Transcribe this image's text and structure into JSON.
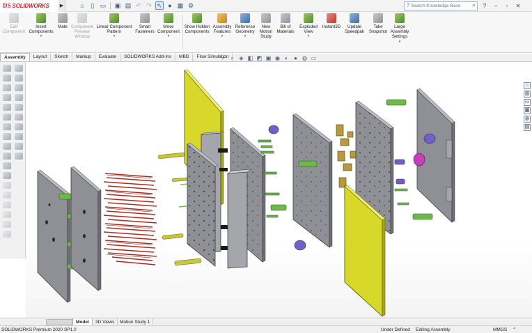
{
  "app": {
    "brand": "SOLIDWORKS",
    "brand_mark": "DS"
  },
  "search": {
    "placeholder": "Search Knowledge Base"
  },
  "ribbon": {
    "buttons": [
      {
        "label": "Edit Component",
        "disabled": true
      },
      {
        "label": "Insert Components",
        "disabled": false
      },
      {
        "label": "Mate",
        "disabled": false
      },
      {
        "label": "Component Preview Window",
        "disabled": true
      },
      {
        "label": "Linear Component Pattern",
        "disabled": false
      },
      {
        "label": "Smart Fasteners",
        "disabled": false
      },
      {
        "label": "Move Component",
        "disabled": false
      },
      {
        "label": "Show Hidden Components",
        "disabled": false
      },
      {
        "label": "Assembly Features",
        "disabled": false
      },
      {
        "label": "Reference Geometry",
        "disabled": false
      },
      {
        "label": "New Motion Study",
        "disabled": false
      },
      {
        "label": "Bill of Materials",
        "disabled": false
      },
      {
        "label": "Exploded View",
        "disabled": false
      },
      {
        "label": "Instant3D",
        "disabled": false
      },
      {
        "label": "Update Speedpak",
        "disabled": false
      },
      {
        "label": "Take Snapshot",
        "disabled": false
      },
      {
        "label": "Large Assembly Settings",
        "disabled": false
      }
    ]
  },
  "tabs": [
    "Assembly",
    "Layout",
    "Sketch",
    "Markup",
    "Evaluate",
    "SOLIDWORKS Add-Ins",
    "MBD",
    "Flow Simulation"
  ],
  "active_tab": "Assembly",
  "bottom_tabs": [
    "Model",
    "3D Views",
    "Motion Study 1"
  ],
  "active_bottom_tab": "Model",
  "status": {
    "product": "SOLIDWORKS Premium 2020 SP1.0",
    "state": "Under Defined",
    "mode": "Editing Assembly",
    "units": "MMGS"
  },
  "colors": {
    "plate_gray": "#8e9096",
    "plate_yellow": "#d8d82a",
    "pin_green": "#6fb84a",
    "pin_red": "#b22a1e",
    "bushing_purple": "#7060c8",
    "bushing_magenta": "#c640b8",
    "brand_red": "#d6202b"
  }
}
